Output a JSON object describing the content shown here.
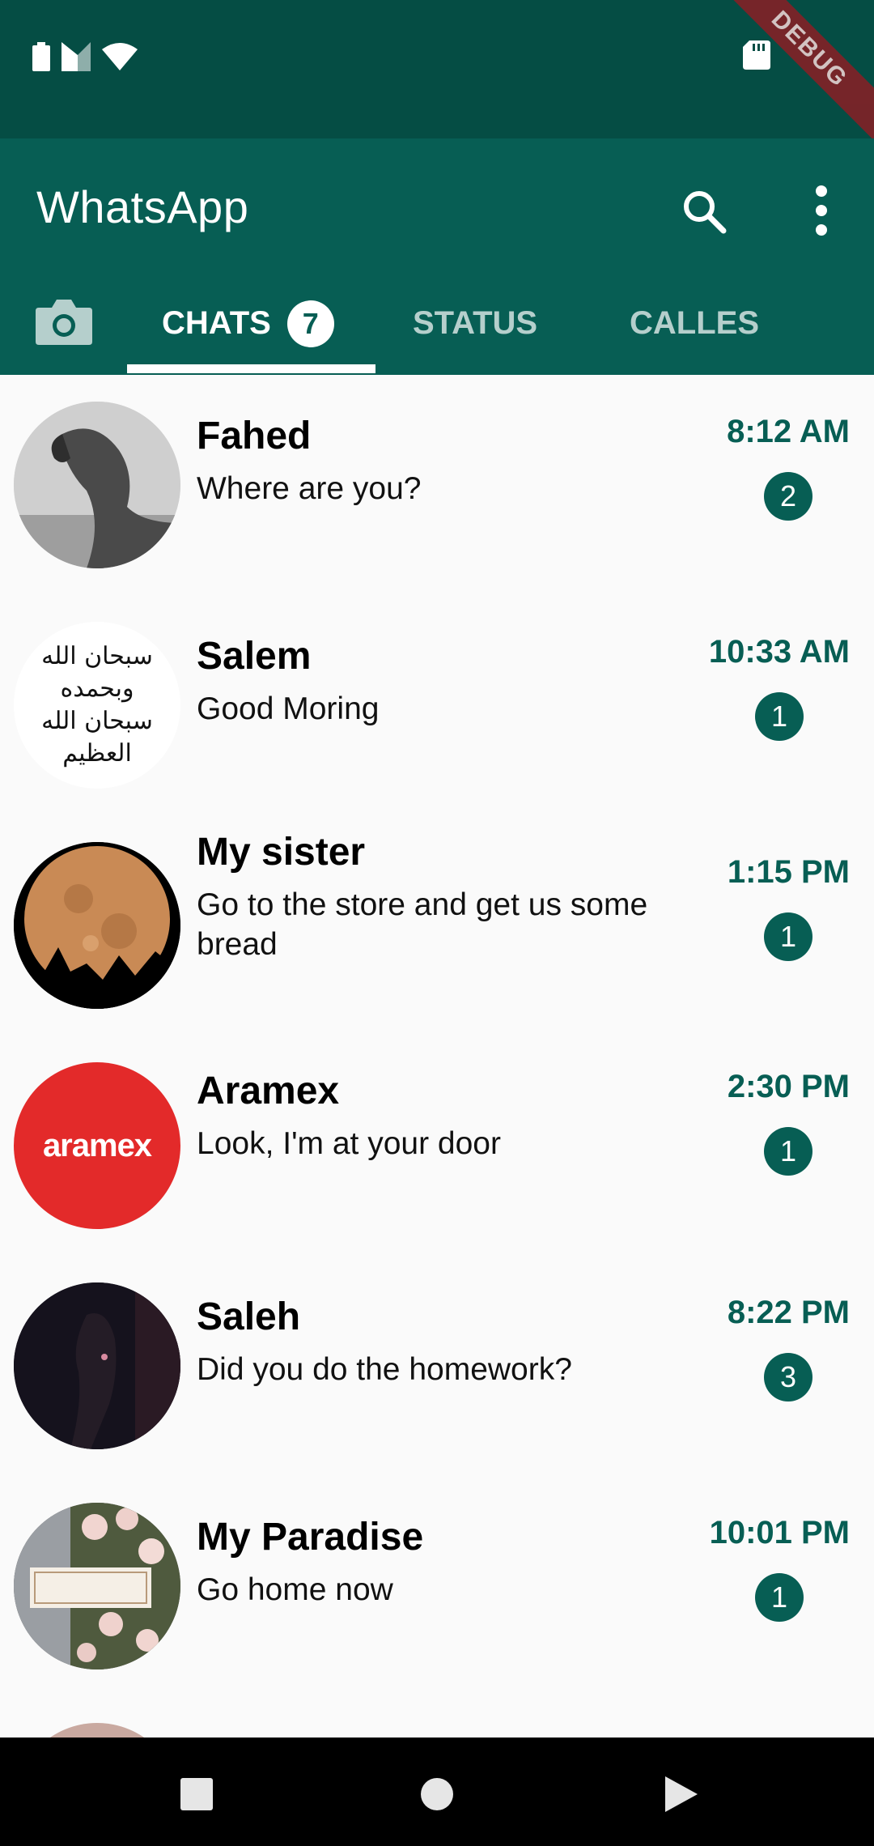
{
  "status_bar": {
    "icons": [
      "battery-icon",
      "signal-icon",
      "wifi-icon",
      "sd-card-icon"
    ],
    "debug_label": "DEBUG"
  },
  "app_bar": {
    "title": "WhatsApp",
    "color": "#075e54",
    "actions": [
      "search-icon",
      "more-vert-icon"
    ]
  },
  "tabs": {
    "camera_icon": "camera-icon",
    "items": [
      {
        "label": "CHATS",
        "badge": "7",
        "active": true
      },
      {
        "label": "STATUS",
        "active": false
      },
      {
        "label": "CALLES",
        "active": false
      }
    ]
  },
  "chats": [
    {
      "name": "Fahed",
      "message": "Where are you?",
      "time": "8:12 AM",
      "unread": "2",
      "avatar": "horse-photo"
    },
    {
      "name": "Salem",
      "message": "Good Moring",
      "time": "10:33 AM",
      "unread": "1",
      "avatar": "calligraphy-image",
      "avatar_text": "سبحان الله وبحمده سبحان الله العظيم"
    },
    {
      "name": "My sister",
      "message": "Go to the store and get us some bread",
      "time": "1:15 PM",
      "unread": "1",
      "avatar": "moon-photo"
    },
    {
      "name": "Aramex",
      "message": "Look, I'm at your door",
      "time": "2:30 PM",
      "unread": "1",
      "avatar": "aramex-logo",
      "avatar_text": "aramex"
    },
    {
      "name": "Saleh",
      "message": "Did you do the homework?",
      "time": "8:22 PM",
      "unread": "3",
      "avatar": "dark-horse-photo"
    },
    {
      "name": "My Paradise",
      "message": "Go home now",
      "time": "10:01 PM",
      "unread": "1",
      "avatar": "roses-photo"
    }
  ],
  "nav_bar": {
    "buttons": [
      "recents-square-icon",
      "home-circle-icon",
      "back-triangle-icon"
    ]
  }
}
